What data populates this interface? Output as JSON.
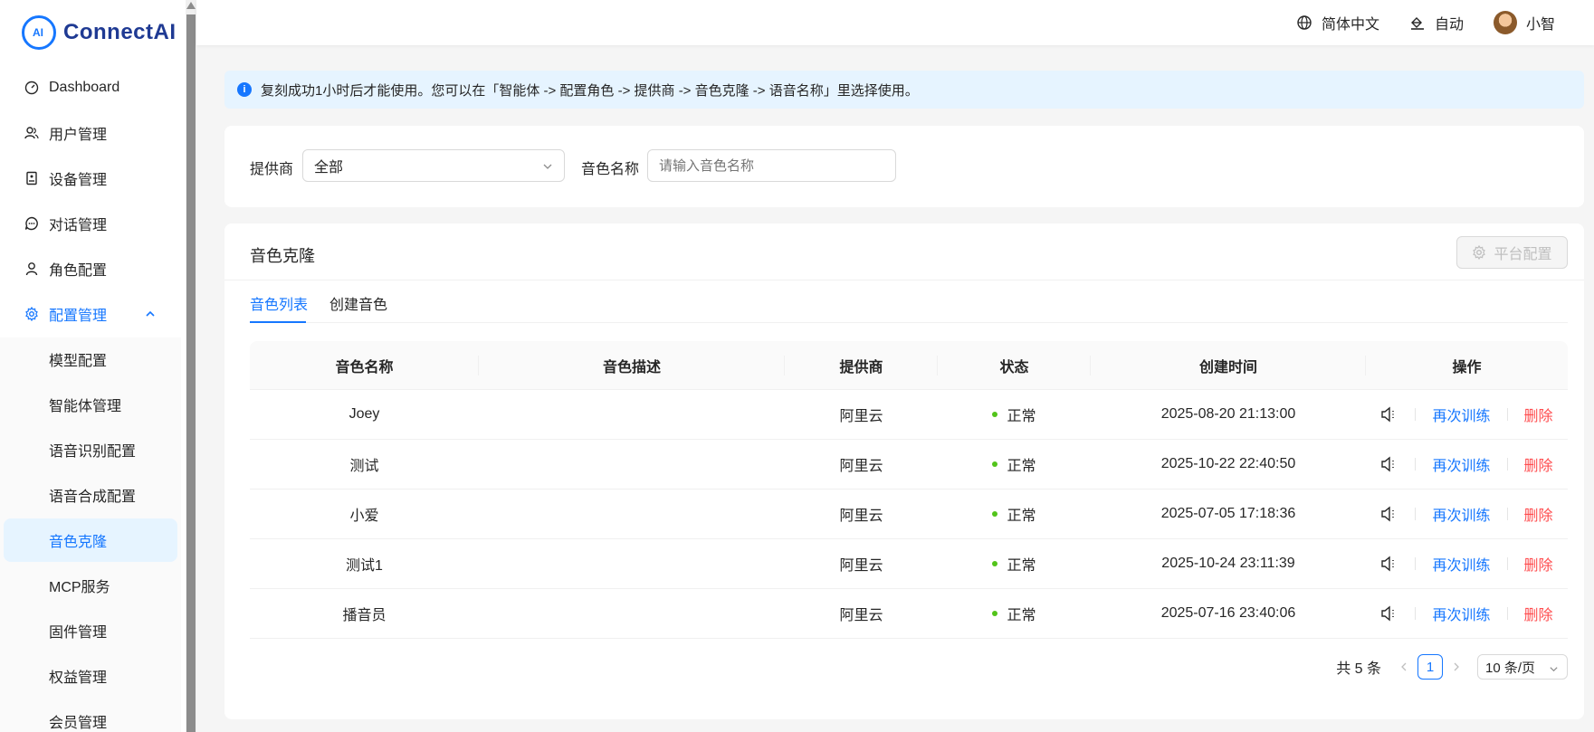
{
  "brand": {
    "name": "ConnectAI"
  },
  "sidebar": {
    "items": [
      {
        "label": "Dashboard",
        "icon": "dashboard-icon"
      },
      {
        "label": "用户管理",
        "icon": "users-icon"
      },
      {
        "label": "设备管理",
        "icon": "device-icon"
      },
      {
        "label": "对话管理",
        "icon": "chat-icon"
      },
      {
        "label": "角色配置",
        "icon": "user-icon"
      },
      {
        "label": "配置管理",
        "icon": "gear-icon"
      }
    ],
    "submenu": [
      {
        "label": "模型配置"
      },
      {
        "label": "智能体管理"
      },
      {
        "label": "语音识别配置"
      },
      {
        "label": "语音合成配置"
      },
      {
        "label": "音色克隆"
      },
      {
        "label": "MCP服务"
      },
      {
        "label": "固件管理"
      },
      {
        "label": "权益管理"
      },
      {
        "label": "会员管理"
      }
    ]
  },
  "header": {
    "language": "简体中文",
    "theme": "自动",
    "user": "小智"
  },
  "alert": {
    "text": "复刻成功1小时后才能使用。您可以在「智能体 -> 配置角色 -> 提供商 -> 音色克隆 -> 语音名称」里选择使用。"
  },
  "filters": {
    "provider_label": "提供商",
    "provider_value": "全部",
    "voice_label": "音色名称",
    "voice_placeholder": "请输入音色名称"
  },
  "card": {
    "title": "音色克隆",
    "platform_button": "平台配置",
    "tabs": [
      {
        "label": "音色列表"
      },
      {
        "label": "创建音色"
      }
    ]
  },
  "table": {
    "headers": [
      "音色名称",
      "音色描述",
      "提供商",
      "状态",
      "创建时间",
      "操作"
    ],
    "rows": [
      {
        "name": "Joey",
        "desc": "",
        "provider": "阿里云",
        "status": "正常",
        "created": "2025-08-20 21:13:00"
      },
      {
        "name": "测试",
        "desc": "",
        "provider": "阿里云",
        "status": "正常",
        "created": "2025-10-22 22:40:50"
      },
      {
        "name": "小爱",
        "desc": "",
        "provider": "阿里云",
        "status": "正常",
        "created": "2025-07-05 17:18:36"
      },
      {
        "name": "测试1",
        "desc": "",
        "provider": "阿里云",
        "status": "正常",
        "created": "2025-10-24 23:11:39"
      },
      {
        "name": "播音员",
        "desc": "",
        "provider": "阿里云",
        "status": "正常",
        "created": "2025-07-16 23:40:06"
      }
    ],
    "actions": {
      "retrain": "再次训练",
      "delete": "删除"
    }
  },
  "pagination": {
    "total": "共 5 条",
    "current": "1",
    "page_size": "10 条/页"
  },
  "colors": {
    "primary": "#1677ff",
    "danger": "#ff4d4f",
    "success": "#52c41a",
    "alert_bg": "#e6f4ff"
  }
}
